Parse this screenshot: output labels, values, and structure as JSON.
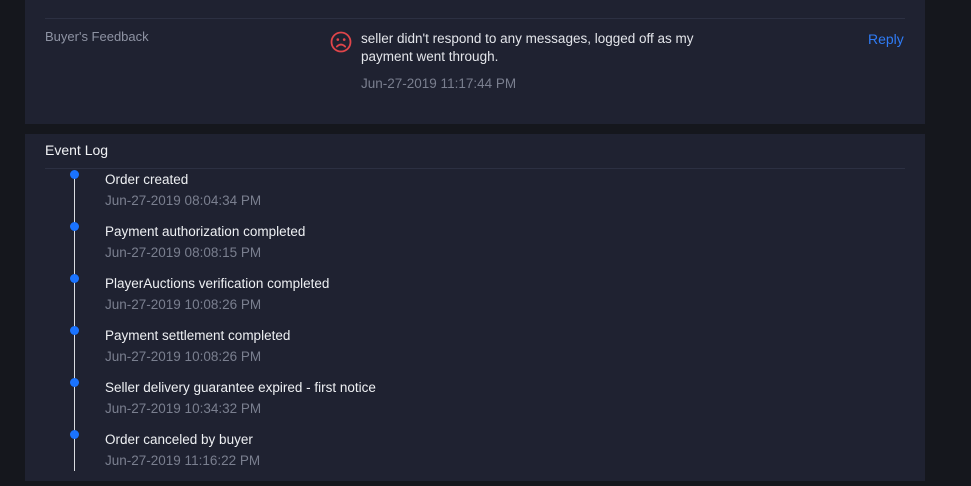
{
  "feedback": {
    "label": "Buyer's Feedback",
    "sentiment_icon": "sad-face-icon",
    "text": "seller didn't respond to any messages, logged off as my payment went through.",
    "timestamp": "Jun-27-2019 11:17:44 PM",
    "reply_label": "Reply"
  },
  "event_log": {
    "title": "Event Log",
    "events": [
      {
        "title": "Order created",
        "time": "Jun-27-2019 08:04:34 PM"
      },
      {
        "title": "Payment authorization completed",
        "time": "Jun-27-2019 08:08:15 PM"
      },
      {
        "title": "PlayerAuctions verification completed",
        "time": "Jun-27-2019 10:08:26 PM"
      },
      {
        "title": "Payment settlement completed",
        "time": "Jun-27-2019 10:08:26 PM"
      },
      {
        "title": "Seller delivery guarantee expired - first notice",
        "time": "Jun-27-2019 10:34:32 PM"
      },
      {
        "title": "Order canceled by buyer",
        "time": "Jun-27-2019 11:16:22 PM"
      }
    ]
  },
  "colors": {
    "accent": "#2f7cf6",
    "timeline_dot": "#1a73ff",
    "sad_icon": "#e0454a",
    "panel_bg": "#1f2231",
    "page_bg": "#15171d"
  }
}
